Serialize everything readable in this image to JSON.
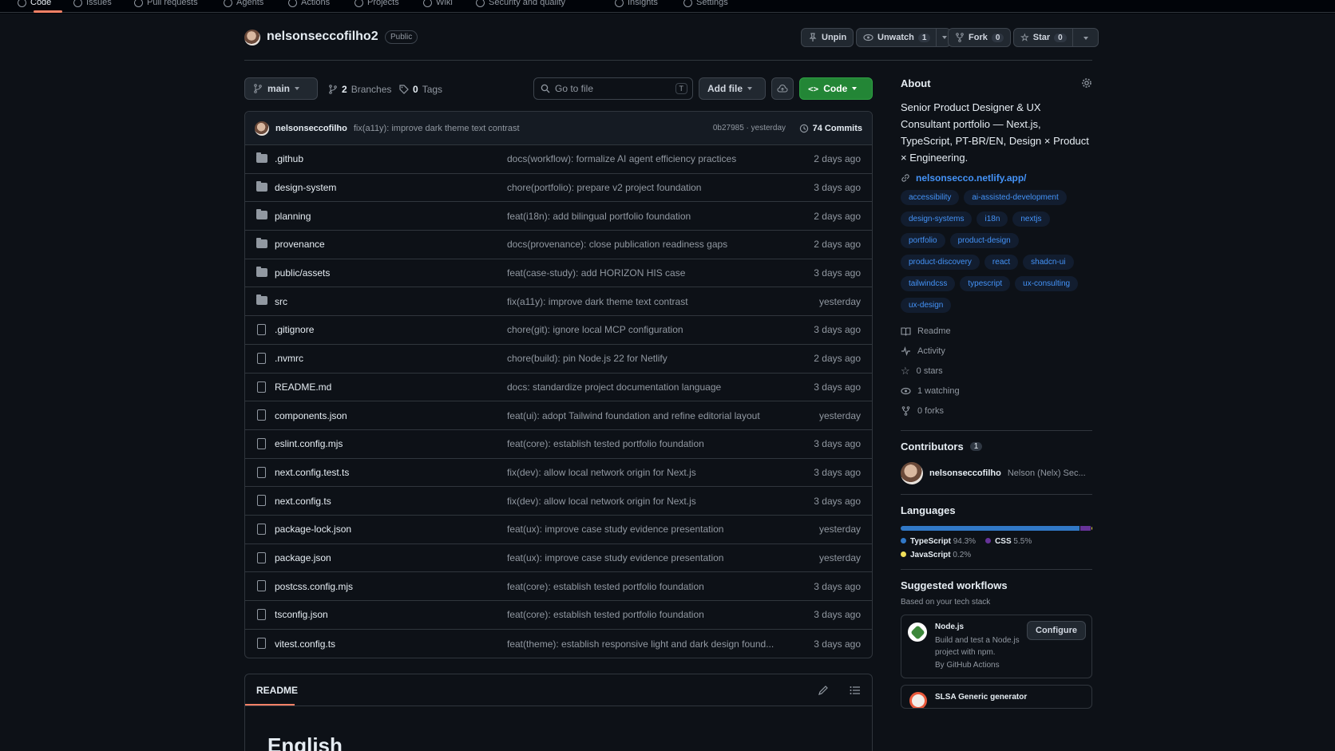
{
  "nav": {
    "tabs": [
      {
        "label": "Code"
      },
      {
        "label": "Issues"
      },
      {
        "label": "Pull requests"
      },
      {
        "label": "Agents"
      },
      {
        "label": "Actions"
      },
      {
        "label": "Projects"
      },
      {
        "label": "Wiki"
      },
      {
        "label": "Security and quality"
      },
      {
        "label": "Insights"
      },
      {
        "label": "Settings"
      }
    ]
  },
  "repo": {
    "name": "nelsonseccofilho2",
    "visibility": "Public",
    "unpin_label": "Unpin",
    "unwatch_label": "Unwatch",
    "watch_count": "1",
    "fork_label": "Fork",
    "fork_count": "0",
    "star_label": "Star",
    "star_count": "0"
  },
  "toolbar": {
    "branch": "main",
    "branches_count": "2",
    "branches_label": "Branches",
    "tags_count": "0",
    "tags_label": "Tags",
    "search_placeholder": "Go to file",
    "search_shortcut": "T",
    "add_file_label": "Add file",
    "code_label": "Code"
  },
  "latest_commit": {
    "author": "nelsonseccofilho",
    "message": "fix(a11y): improve dark theme text contrast",
    "hash_time": "0b27985 · yesterday",
    "commits_label": "74 Commits"
  },
  "files": [
    {
      "type": "folder",
      "name": ".github",
      "message": "docs(workflow): formalize AI agent efficiency practices",
      "date": "2 days ago"
    },
    {
      "type": "folder",
      "name": "design-system",
      "message": "chore(portfolio): prepare v2 project foundation",
      "date": "3 days ago"
    },
    {
      "type": "folder",
      "name": "planning",
      "message": "feat(i18n): add bilingual portfolio foundation",
      "date": "2 days ago"
    },
    {
      "type": "folder",
      "name": "provenance",
      "message": "docs(provenance): close publication readiness gaps",
      "date": "2 days ago"
    },
    {
      "type": "folder",
      "name": "public/assets",
      "message": "feat(case-study): add HORIZON HIS case",
      "date": "3 days ago"
    },
    {
      "type": "folder",
      "name": "src",
      "message": "fix(a11y): improve dark theme text contrast",
      "date": "yesterday"
    },
    {
      "type": "file",
      "name": ".gitignore",
      "message": "chore(git): ignore local MCP configuration",
      "date": "3 days ago"
    },
    {
      "type": "file",
      "name": ".nvmrc",
      "message": "chore(build): pin Node.js 22 for Netlify",
      "date": "2 days ago"
    },
    {
      "type": "file",
      "name": "README.md",
      "message": "docs: standardize project documentation language",
      "date": "3 days ago"
    },
    {
      "type": "file",
      "name": "components.json",
      "message": "feat(ui): adopt Tailwind foundation and refine editorial layout",
      "date": "yesterday"
    },
    {
      "type": "file",
      "name": "eslint.config.mjs",
      "message": "feat(core): establish tested portfolio foundation",
      "date": "3 days ago"
    },
    {
      "type": "file",
      "name": "next.config.test.ts",
      "message": "fix(dev): allow local network origin for Next.js",
      "date": "3 days ago"
    },
    {
      "type": "file",
      "name": "next.config.ts",
      "message": "fix(dev): allow local network origin for Next.js",
      "date": "3 days ago"
    },
    {
      "type": "file",
      "name": "package-lock.json",
      "message": "feat(ux): improve case study evidence presentation",
      "date": "yesterday"
    },
    {
      "type": "file",
      "name": "package.json",
      "message": "feat(ux): improve case study evidence presentation",
      "date": "yesterday"
    },
    {
      "type": "file",
      "name": "postcss.config.mjs",
      "message": "feat(core): establish tested portfolio foundation",
      "date": "3 days ago"
    },
    {
      "type": "file",
      "name": "tsconfig.json",
      "message": "feat(core): establish tested portfolio foundation",
      "date": "3 days ago"
    },
    {
      "type": "file",
      "name": "vitest.config.ts",
      "message": "feat(theme): establish responsive light and dark design found...",
      "date": "3 days ago"
    }
  ],
  "readme": {
    "tab_label": "README",
    "heading": "English"
  },
  "about": {
    "title": "About",
    "description": "Senior Product Designer & UX Consultant portfolio — Next.js, TypeScript, PT-BR/EN, Design × Product × Engineering.",
    "website": "nelsonsecco.netlify.app/",
    "topics": [
      "accessibility",
      "ai-assisted-development",
      "design-systems",
      "i18n",
      "nextjs",
      "portfolio",
      "product-design",
      "product-discovery",
      "react",
      "shadcn-ui",
      "tailwindcss",
      "typescript",
      "ux-consulting",
      "ux-design"
    ],
    "readme_label": "Readme",
    "activity_label": "Activity",
    "stars_label": "0 stars",
    "watching_label": "1 watching",
    "forks_label": "0 forks"
  },
  "contributors": {
    "title": "Contributors",
    "count": "1",
    "login": "nelsonseccofilho",
    "name": "Nelson (Nelx) Sec..."
  },
  "languages": {
    "title": "Languages",
    "items": [
      {
        "name": "TypeScript",
        "percent": "94.3%",
        "value": 94.3,
        "color": "#3178c6"
      },
      {
        "name": "CSS",
        "percent": "5.5%",
        "value": 5.5,
        "color": "#663399"
      },
      {
        "name": "JavaScript",
        "percent": "0.2%",
        "value": 0.2,
        "color": "#f1e05a"
      }
    ]
  },
  "workflows": {
    "title": "Suggested workflows",
    "subtitle": "Based on your tech stack",
    "card_title": "Node.js",
    "card_desc": "Build and test a Node.js project with npm.",
    "card_author": "By GitHub Actions",
    "configure_label": "Configure",
    "next_card_title": "SLSA Generic generator"
  },
  "colors": {
    "accent_link": "#4493f8",
    "primary_button": "#238636",
    "tab_underline": "#f78166"
  }
}
